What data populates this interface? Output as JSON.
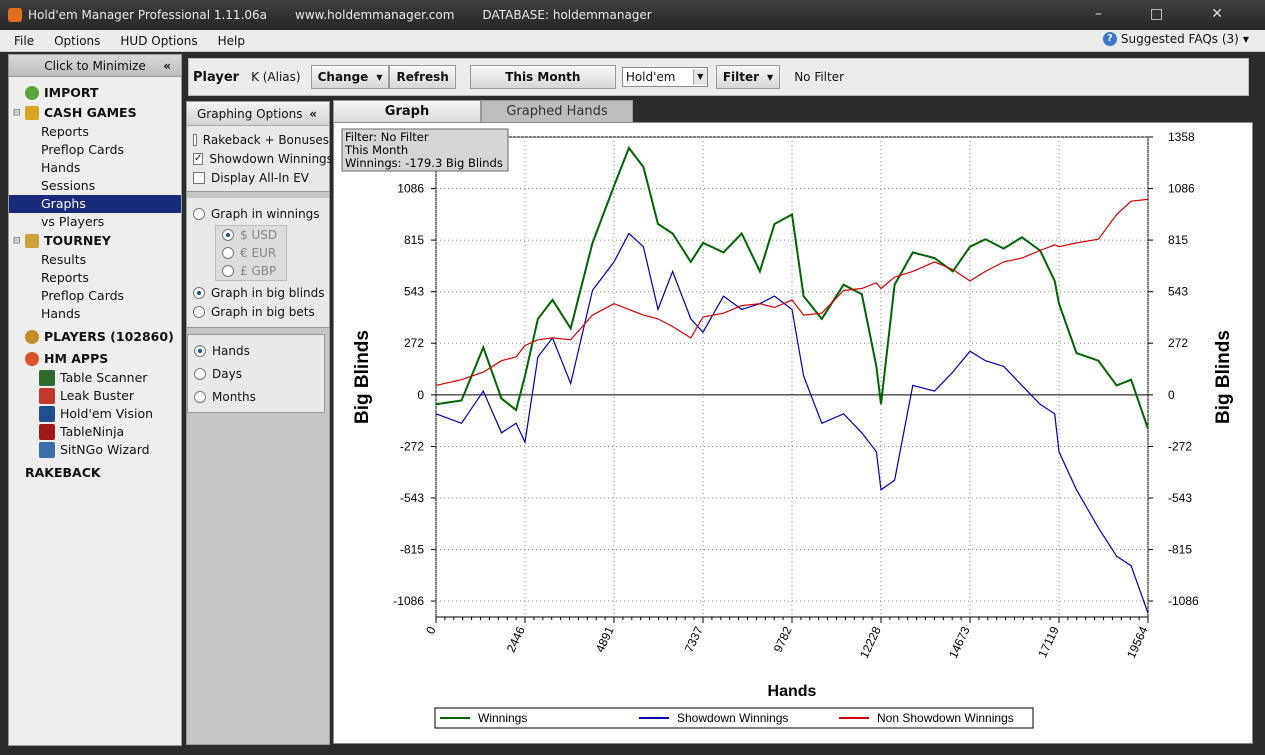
{
  "window": {
    "title": "Hold'em Manager Professional 1.11.06a",
    "url": "www.holdemmanager.com",
    "database": "DATABASE: holdemmanager"
  },
  "menu": {
    "items": [
      "File",
      "Options",
      "HUD Options",
      "Help"
    ],
    "faq": "Suggested FAQs (3)"
  },
  "left": {
    "minimize": "Click to Minimize",
    "import": "IMPORT",
    "cash": {
      "label": "CASH GAMES",
      "items": [
        "Reports",
        "Preflop Cards",
        "Hands",
        "Sessions",
        "Graphs",
        "vs Players"
      ]
    },
    "tourney": {
      "label": "TOURNEY",
      "items": [
        "Results",
        "Reports",
        "Preflop Cards",
        "Hands"
      ]
    },
    "players": "PLAYERS (102860)",
    "hmapps": {
      "label": "HM APPS",
      "items": [
        "Table Scanner",
        "Leak Buster",
        "Hold'em Vision",
        "TableNinja",
        "SitNGo Wizard"
      ]
    },
    "rakeback": "RAKEBACK"
  },
  "topbar": {
    "player_label": "Player",
    "player_name": "K (Alias)",
    "change": "Change",
    "refresh": "Refresh",
    "period": "This Month",
    "game": "Hold'em",
    "filter": "Filter",
    "filter_status": "No Filter"
  },
  "options": {
    "header": "Graphing Options",
    "checks": [
      {
        "label": "Rakeback + Bonuses",
        "checked": false
      },
      {
        "label": "Showdown Winnings",
        "checked": true
      },
      {
        "label": "Display All-In EV",
        "checked": false
      }
    ],
    "graph_in_winnings": "Graph in winnings",
    "currencies": [
      "$ USD",
      "€ EUR",
      "£ GBP"
    ],
    "graph_in_bb": "Graph in big blinds",
    "graph_in_bets": "Graph in big bets",
    "xaxis": [
      "Hands",
      "Days",
      "Months"
    ]
  },
  "tabs": {
    "graph": "Graph",
    "graphed_hands": "Graphed Hands"
  },
  "colors": {
    "winnings": "#006400",
    "showdown": "#0000b0",
    "nonshowdown": "#d40000",
    "selection": "#1a2a7a"
  },
  "chart_data": {
    "type": "line",
    "info_box": [
      "Filter: No Filter",
      "This Month",
      "Winnings: -179.3 Big Blinds"
    ],
    "xlabel": "Hands",
    "ylabel": "Big Blinds",
    "ylabel_right": "Big Blinds",
    "xlim": [
      0,
      19564
    ],
    "ylim": [
      -1170,
      1358
    ],
    "x_ticks": [
      "0",
      "2446",
      "4891",
      "7337",
      "9782",
      "12228",
      "14673",
      "17119",
      "19564"
    ],
    "y_ticks": [
      "1358",
      "1086",
      "815",
      "543",
      "272",
      "0",
      "-272",
      "-543",
      "-815",
      "-1086"
    ],
    "grid": true,
    "legend": "bottom",
    "x": [
      0,
      700,
      1300,
      1800,
      2200,
      2446,
      2800,
      3200,
      3700,
      4300,
      4891,
      5300,
      5700,
      6100,
      6500,
      7000,
      7337,
      7900,
      8400,
      8900,
      9300,
      9782,
      10100,
      10600,
      11200,
      11700,
      12100,
      12228,
      12600,
      13100,
      13700,
      14200,
      14673,
      15100,
      15600,
      16100,
      16600,
      17000,
      17119,
      17600,
      18200,
      18700,
      19100,
      19564
    ],
    "series": [
      {
        "name": "Winnings",
        "values": [
          -50,
          -30,
          250,
          -20,
          -80,
          100,
          400,
          500,
          350,
          800,
          1100,
          1300,
          1200,
          900,
          850,
          700,
          800,
          750,
          850,
          650,
          900,
          950,
          520,
          400,
          580,
          530,
          150,
          -50,
          580,
          750,
          720,
          650,
          780,
          820,
          770,
          830,
          760,
          600,
          480,
          220,
          180,
          50,
          80,
          -179
        ]
      },
      {
        "name": "Showdown Winnings",
        "values": [
          -100,
          -150,
          20,
          -200,
          -150,
          -250,
          200,
          300,
          60,
          550,
          700,
          850,
          780,
          450,
          650,
          400,
          330,
          520,
          450,
          480,
          520,
          450,
          100,
          -150,
          -100,
          -200,
          -300,
          -500,
          -450,
          50,
          20,
          120,
          230,
          180,
          150,
          50,
          -50,
          -100,
          -300,
          -500,
          -700,
          -850,
          -900,
          -1150
        ]
      },
      {
        "name": "Non Showdown Winnings",
        "values": [
          50,
          80,
          120,
          180,
          200,
          260,
          290,
          300,
          290,
          420,
          480,
          450,
          420,
          400,
          360,
          300,
          410,
          430,
          470,
          480,
          460,
          500,
          420,
          430,
          550,
          560,
          590,
          560,
          620,
          650,
          700,
          660,
          600,
          650,
          700,
          720,
          760,
          790,
          780,
          800,
          820,
          950,
          1020,
          1030
        ]
      }
    ]
  }
}
